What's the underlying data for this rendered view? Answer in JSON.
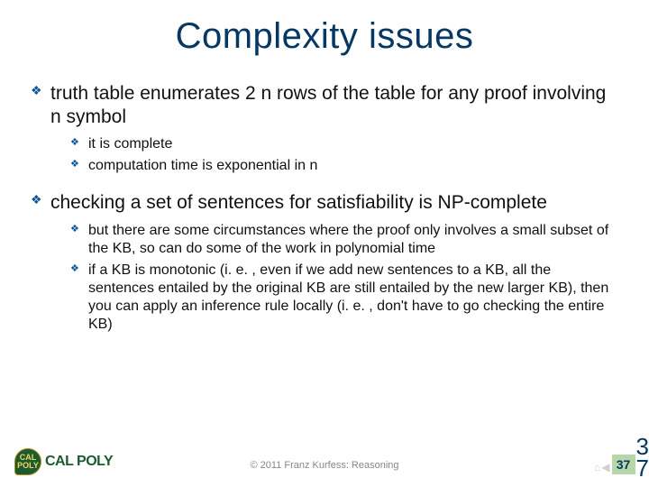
{
  "title": "Complexity issues",
  "bullets": {
    "b1": "truth table enumerates 2 n rows of the table for any proof involving n symbol",
    "b1a": "it is complete",
    "b1b": "computation time is exponential in n",
    "b2": "checking a set of sentences for satisfiability is NP-complete",
    "b2a": "but there are some circumstances where the proof only involves a small subset of the KB, so can do some of the work in polynomial time",
    "b2b": "if a KB is monotonic (i. e. , even if we add new sentences to a KB, all the sentences entailed by the original KB are still entailed by the new larger KB), then you can apply an inference rule locally (i. e. , don't have to go checking the entire KB)"
  },
  "footer": {
    "logo_badge": "CAL POLY",
    "logo_text": "CAL POLY",
    "copyright": "© 2011   Franz Kurfess: Reasoning",
    "page_small": "37",
    "page_big_top": "3",
    "page_big_bottom": "7"
  }
}
